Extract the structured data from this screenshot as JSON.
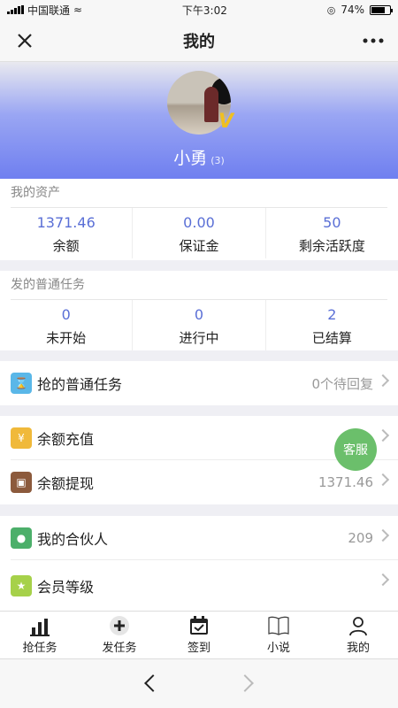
{
  "status_bar": {
    "carrier": "中国联通",
    "time": "下午3:02",
    "battery": "74%",
    "battery_level": 0.74
  },
  "navbar": {
    "title": "我的"
  },
  "profile": {
    "name": "小勇",
    "count": "(3)",
    "badge": "V"
  },
  "assets": {
    "title": "我的资产",
    "items": [
      {
        "value": "1371.46",
        "label": "余额"
      },
      {
        "value": "0.00",
        "label": "保证金"
      },
      {
        "value": "50",
        "label": "剩余活跃度"
      }
    ]
  },
  "tasks": {
    "title": "发的普通任务",
    "items": [
      {
        "value": "0",
        "label": "未开始"
      },
      {
        "value": "0",
        "label": "进行中"
      },
      {
        "value": "2",
        "label": "已结算"
      }
    ]
  },
  "menu": {
    "grab_task": {
      "label": "抢的普通任务",
      "value": "0个待回复"
    },
    "recharge": {
      "label": "余额充值",
      "value": ""
    },
    "withdraw": {
      "label": "余额提现",
      "value": "1371.46"
    },
    "partners": {
      "label": "我的合伙人",
      "value": "209"
    },
    "level": {
      "label": "会员等级",
      "value": ""
    }
  },
  "floating": {
    "service": "客服"
  },
  "tabbar": {
    "items": [
      {
        "label": "抢任务"
      },
      {
        "label": "发任务"
      },
      {
        "label": "签到"
      },
      {
        "label": "小说"
      },
      {
        "label": "我的"
      }
    ]
  },
  "colors": {
    "accent": "#5a6fd6",
    "grab_icon": "#5ab7e8",
    "recharge_icon": "#f0b93a",
    "withdraw_icon": "#8c5a3c",
    "partners_icon": "#4caf6a",
    "level_icon": "#a6d14a",
    "service": "#6bbf6b"
  }
}
